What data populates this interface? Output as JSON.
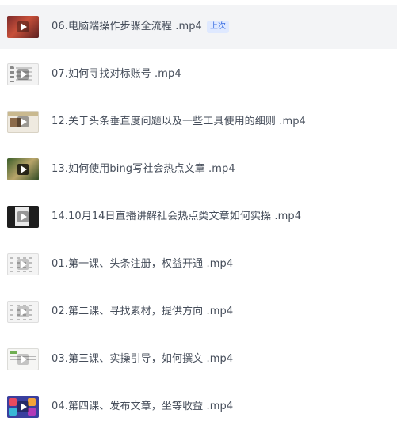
{
  "files": [
    {
      "title": "06.电脑端操作步骤全流程 .mp4",
      "badge": "上次",
      "thumb": "red-photo",
      "active": true
    },
    {
      "title": "07.如何寻找对标账号 .mp4",
      "badge": "",
      "thumb": "doc-list",
      "active": false
    },
    {
      "title": "12.关于头条垂直度问题以及一些工具使用的细则 .mp4",
      "badge": "",
      "thumb": "web-page",
      "active": false
    },
    {
      "title": "13.如何使用bing写社会热点文章 .mp4",
      "badge": "",
      "thumb": "green-photo",
      "active": false
    },
    {
      "title": "14.10月14日直播讲解社会热点类文章如何实操 .mp4",
      "badge": "",
      "thumb": "dark-screen",
      "active": false
    },
    {
      "title": "01.第一课、头条注册，权益开通 .mp4",
      "badge": "",
      "thumb": "grid-screen",
      "active": false
    },
    {
      "title": "02.第二课、寻找素材，提供方向 .mp4",
      "badge": "",
      "thumb": "grid-screen",
      "active": false
    },
    {
      "title": "03.第三课、实操引导，如何撰文 .mp4",
      "badge": "",
      "thumb": "sheet-screen",
      "active": false
    },
    {
      "title": "04.第四课、发布文章，坐等收益 .mp4",
      "badge": "",
      "thumb": "colorful-screen",
      "active": false
    }
  ],
  "icons": {
    "play": "play-icon"
  },
  "colors": {
    "active_row_bg": "#f3f4f6",
    "title_text": "#454d5a",
    "badge_text": "#3b6fe0",
    "badge_bg": "#dfe9ff"
  }
}
